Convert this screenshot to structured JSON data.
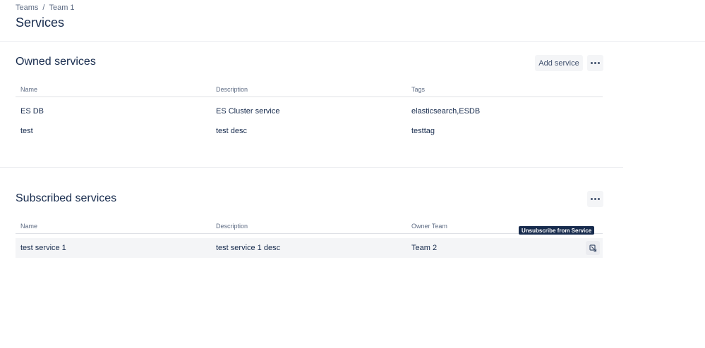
{
  "breadcrumb": {
    "items": [
      "Teams",
      "Team 1"
    ],
    "separator": "/"
  },
  "page": {
    "title": "Services"
  },
  "owned": {
    "title": "Owned services",
    "add_button": "Add service",
    "columns": [
      "Name",
      "Description",
      "Tags"
    ],
    "rows": [
      [
        "ES DB",
        "ES Cluster service",
        "elasticsearch,ESDB"
      ],
      [
        "test",
        "test desc",
        "testtag"
      ]
    ]
  },
  "subscribed": {
    "title": "Subscribed services",
    "columns": [
      "Name",
      "Description",
      "Owner Team"
    ],
    "rows": [
      [
        "test service 1",
        "test service 1 desc",
        "Team 2"
      ]
    ],
    "tooltip": "Unsubscribe from Service"
  },
  "icons": {
    "more": "more-horizontal-icon",
    "unsubscribe": "unsubscribe-icon"
  },
  "colors": {
    "text": "#172b4d",
    "muted": "#5e6c84",
    "button_bg": "#f4f5f7",
    "tooltip_bg": "#172b4d"
  }
}
